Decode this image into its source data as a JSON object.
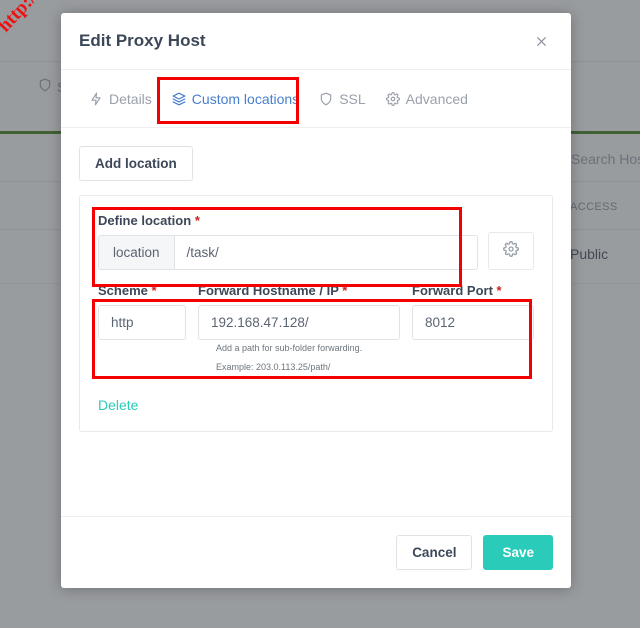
{
  "background": {
    "tabs": [
      {
        "label": "SSL",
        "icon": "shield-icon"
      }
    ],
    "search_placeholder": "Search Host...",
    "table_header": "ACCESS",
    "table_cell": "Public"
  },
  "watermark": {
    "text": "http://hull.kr",
    "color": "#ee1111"
  },
  "modal": {
    "title": "Edit Proxy Host",
    "close_label": "✕",
    "tabs": [
      {
        "label": "Details",
        "icon": "lightning-icon",
        "active": false
      },
      {
        "label": "Custom locations",
        "icon": "layers-icon",
        "active": true
      },
      {
        "label": "SSL",
        "icon": "shield-icon",
        "active": false
      },
      {
        "label": "Advanced",
        "icon": "gear-icon",
        "active": false
      }
    ],
    "add_location_label": "Add location",
    "location": {
      "define_label": "Define location",
      "define_required": "*",
      "prefix": "location",
      "path_value": "/task/",
      "settings_icon": "gear-icon",
      "scheme_label": "Scheme",
      "scheme_required": "*",
      "scheme_value": "http",
      "host_label": "Forward Hostname / IP",
      "host_required": "*",
      "host_value": "192.168.47.128/",
      "port_label": "Forward Port",
      "port_required": "*",
      "port_value": "8012",
      "helper_line1": "Add a path for sub-folder forwarding.",
      "helper_line2": "Example: 203.0.113.25/path/",
      "delete_label": "Delete"
    },
    "footer": {
      "cancel_label": "Cancel",
      "save_label": "Save"
    }
  },
  "colors": {
    "accent_teal": "#2bcbba",
    "tab_active_blue": "#467fcf",
    "required_red": "#cd201f",
    "annotation_red": "#f40000",
    "green_bar": "#3c7d13"
  }
}
